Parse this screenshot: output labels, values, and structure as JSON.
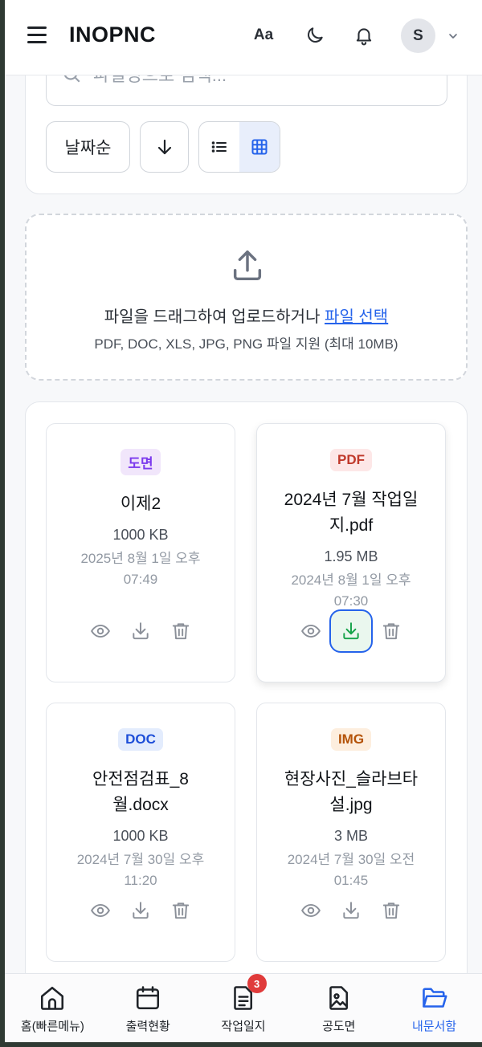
{
  "header": {
    "brand": "INOPNC",
    "font_size_label": "Aa",
    "avatar_initial": "S"
  },
  "search": {
    "placeholder": "파일명으로 검색..."
  },
  "controls": {
    "sort_label": "날짜순",
    "sort_direction": "descending",
    "view_mode": "grid"
  },
  "upload": {
    "prompt": "파일을 드래그하여 업로드하거나 ",
    "link": "파일 선택",
    "hint": "PDF, DOC, XLS, JPG, PNG 파일 지원 (최대 10MB)"
  },
  "files": [
    {
      "badge": "도면",
      "badge_bg": "#f1e6fb",
      "badge_fg": "#7c3aed",
      "name": "이제2",
      "size": "1000 KB",
      "date": "2025년 8월 1일 오후 07:49"
    },
    {
      "badge": "PDF",
      "badge_bg": "#fde7e7",
      "badge_fg": "#c0392b",
      "name": "2024년 7월 작업일지.pdf",
      "size": "1.95 MB",
      "date": "2024년 8월 1일 오후 07:30"
    },
    {
      "badge": "DOC",
      "badge_bg": "#e3ecfd",
      "badge_fg": "#1d4ed8",
      "name": "안전점검표_8월.docx",
      "size": "1000 KB",
      "date": "2024년 7월 30일 오후 11:20"
    },
    {
      "badge": "IMG",
      "badge_bg": "#fdeede",
      "badge_fg": "#b45309",
      "name": "현장사진_슬라브타설.jpg",
      "size": "3 MB",
      "date": "2024년 7월 30일 오전 01:45"
    }
  ],
  "nav": {
    "items": [
      {
        "label": "홈(빠른메뉴)"
      },
      {
        "label": "출력현황"
      },
      {
        "label": "작업일지",
        "badge": "3"
      },
      {
        "label": "공도면"
      },
      {
        "label": "내문서함"
      }
    ],
    "active_index": 4
  },
  "colors": {
    "accent": "#2563eb",
    "download_focus_bg": "#eaf7ee",
    "download_icon": "#16a34a"
  }
}
